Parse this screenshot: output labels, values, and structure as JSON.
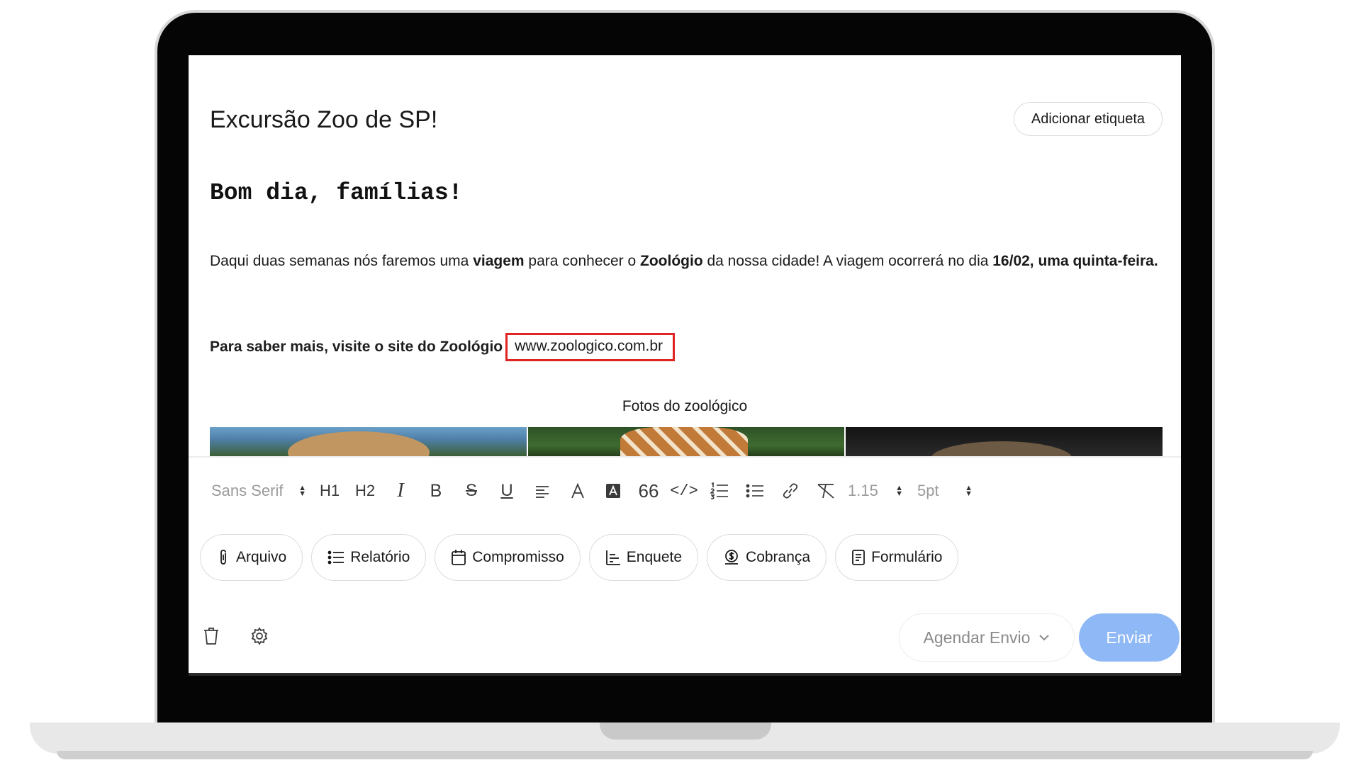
{
  "composer": {
    "subject": "Excursão Zoo de SP!",
    "add_tag_label": "Adicionar etiqueta"
  },
  "body": {
    "greeting": "Bom dia, famílias!",
    "p1": {
      "a": "Daqui duas semanas nós faremos uma ",
      "b": "viagem",
      "c": " para conhecer o ",
      "d": "Zoológio",
      "e": " da nossa cidade! A viagem ocorrerá no dia ",
      "f": "16/02, uma quinta-feira."
    },
    "link_lead": "Para saber mais, visite o site do Zoológio",
    "link_url": "www.zoologico.com.br",
    "photos_caption": "Fotos do zoológico"
  },
  "toolbar": {
    "font_family": "Sans Serif",
    "h1": "H1",
    "h2": "H2",
    "italic": "I",
    "bold": "B",
    "strike": "S",
    "underline": "U",
    "quote": "66",
    "code": "</>",
    "line_height": "1.15",
    "font_size": "5pt"
  },
  "attachments": [
    {
      "label": "Arquivo",
      "icon": "paperclip-icon"
    },
    {
      "label": "Relatório",
      "icon": "list-icon"
    },
    {
      "label": "Compromisso",
      "icon": "calendar-icon"
    },
    {
      "label": "Enquete",
      "icon": "poll-icon"
    },
    {
      "label": "Cobrança",
      "icon": "money-icon"
    },
    {
      "label": "Formulário",
      "icon": "form-icon"
    }
  ],
  "footer": {
    "schedule_label": "Agendar Envio",
    "send_label": "Enviar"
  },
  "colors": {
    "highlight_box": "#e02424",
    "send_button": "#8fb8f6",
    "frame": "#050505"
  }
}
